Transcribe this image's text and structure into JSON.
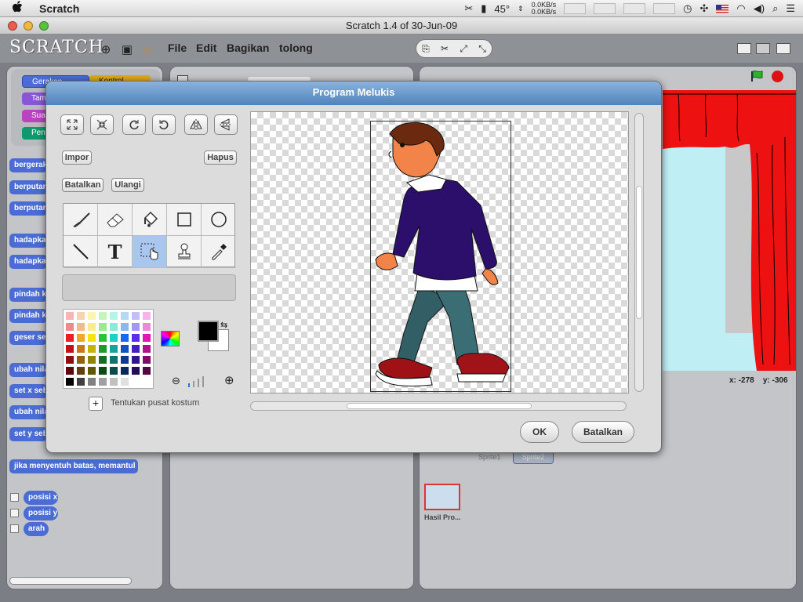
{
  "menubar": {
    "apple": "",
    "app_name": "Scratch",
    "rotation": "45°",
    "net_up": "0.0KB/s",
    "net_down": "0.0KB/s"
  },
  "window": {
    "title": "Scratch 1.4 of 30-Jun-09"
  },
  "scratch": {
    "logo": "SCRATCH",
    "menus": [
      "File",
      "Edit",
      "Bagikan",
      "tolong"
    ],
    "categories": [
      "Gerakan",
      "Kontrol",
      "Tampilan",
      "Suara",
      "Pena"
    ],
    "blocks": [
      "bergerak",
      "berputar",
      "berputar",
      "hadapkan",
      "hadapkan",
      "pindah k",
      "pindah k",
      "geser se",
      "ubah nila",
      "set x seb",
      "ubah nila",
      "set y seb",
      "jika menyentuh batas, memantul"
    ],
    "reporters": [
      "posisi x",
      "posisi y",
      "arah"
    ],
    "sprites": [
      "Sprite1",
      "Sprite2"
    ],
    "stage_thumb_label": "Hasil Pro...",
    "coords": {
      "x_label": "x:",
      "x": "-278",
      "y_label": "y:",
      "y": "-306"
    }
  },
  "dialog": {
    "title": "Program Melukis",
    "import": "Impor",
    "clear": "Hapus",
    "undo": "Batalkan",
    "redo": "Ulangi",
    "set_center": "Tentukan pusat kostum",
    "ok": "OK",
    "cancel": "Batalkan",
    "palette": [
      "#f7b5b5",
      "#f9d3b0",
      "#fbf5b1",
      "#c5f5bb",
      "#b5f5e8",
      "#b5d8f9",
      "#c5bdf7",
      "#f5b5ea",
      "#f08a8a",
      "#f5b98a",
      "#f7ee8a",
      "#99ec8c",
      "#8aecd6",
      "#8ab9f0",
      "#a398f0",
      "#ec8ad8",
      "#ee1c24",
      "#f5a623",
      "#f5e50e",
      "#2bc234",
      "#1bd2c4",
      "#1768f0",
      "#5a2cf0",
      "#e017b5",
      "#c01218",
      "#c8791a",
      "#c4b40a",
      "#1d9a28",
      "#16a39a",
      "#1450c4",
      "#4520bf",
      "#b0128c",
      "#8c0d12",
      "#946012",
      "#908406",
      "#137020",
      "#0f7470",
      "#0e3a90",
      "#33168c",
      "#800c66",
      "#5c080c",
      "#60400c",
      "#5e5804",
      "#0c4a14",
      "#0a4c4a",
      "#09265e",
      "#220e5c",
      "#540842",
      "#000000",
      "#404040",
      "#808080",
      "#a0a0a0",
      "#c0c0c0",
      "#e0e0e0",
      "#ffffff",
      "#ffffff"
    ]
  }
}
